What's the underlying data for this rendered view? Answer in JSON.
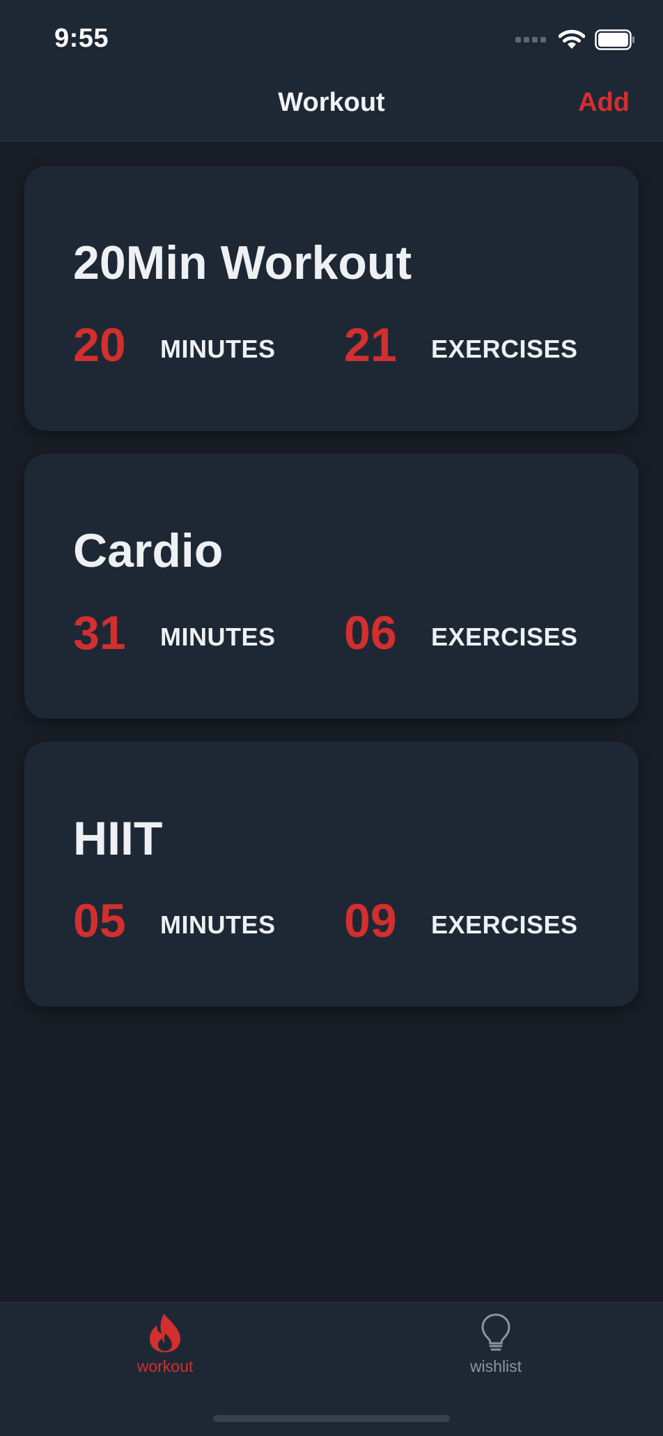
{
  "status_bar": {
    "time": "9:55"
  },
  "nav": {
    "title": "Workout",
    "add_label": "Add"
  },
  "workouts": [
    {
      "title": "20Min Workout",
      "minutes": "20",
      "minutes_label": "MINUTES",
      "exercises": "21",
      "exercises_label": "EXERCISES"
    },
    {
      "title": "Cardio",
      "minutes": "31",
      "minutes_label": "MINUTES",
      "exercises": "06",
      "exercises_label": "EXERCISES"
    },
    {
      "title": "HIIT",
      "minutes": "05",
      "minutes_label": "MINUTES",
      "exercises": "09",
      "exercises_label": "EXERCISES"
    }
  ],
  "tabs": [
    {
      "label": "workout",
      "icon": "flame-icon",
      "active": true
    },
    {
      "label": "wishlist",
      "icon": "lightbulb-icon",
      "active": false
    }
  ],
  "colors": {
    "accent": "#d32f2f",
    "background": "#181d26",
    "card": "#1e2835",
    "inactive": "#8d94a0"
  }
}
